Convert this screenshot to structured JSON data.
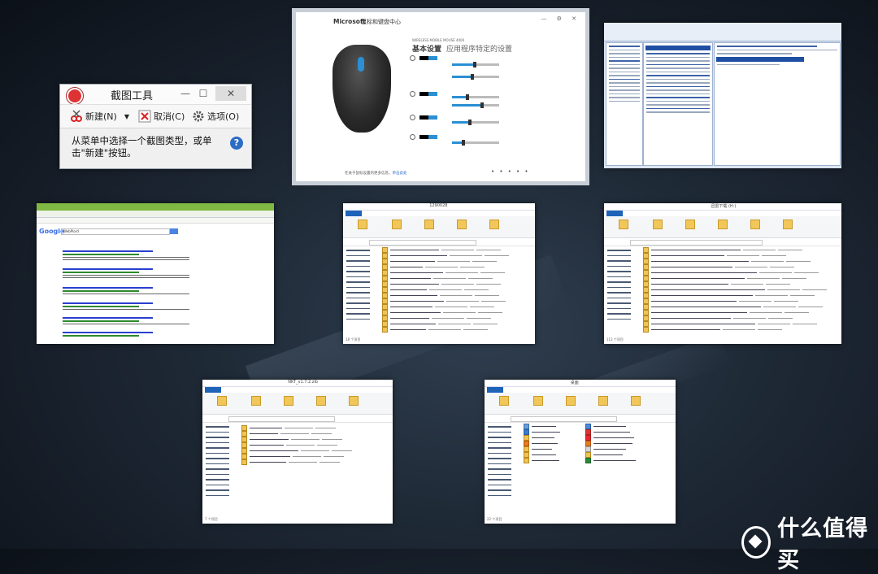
{
  "snipping_tool": {
    "title": "截图工具",
    "new_label": "新建(N)",
    "cancel_label": "取消(C)",
    "options_label": "选项(O)",
    "message": "从菜单中选择一个截图类型，或单击\"新建\"按钮。",
    "help_glyph": "?"
  },
  "mouse_center": {
    "brand": "Microsoft",
    "title": "鼠标和键盘中心",
    "model": "WIRELESS MOBILE MOUSE 4000",
    "heading": "基本设置",
    "heading_sub": "应用程序特定的设置",
    "window_controls": "— ⚙ ✕",
    "footer_text": "在关于鼠标设置的更多信息，",
    "footer_link": "单击此处",
    "page_dots": "• • • • •"
  },
  "browser": {
    "logo": "Google",
    "query": "WebPlord"
  },
  "explorer1": {
    "title": "1290028",
    "status": "18 个项目"
  },
  "explorer2": {
    "title": "迅雷下载 (H:)",
    "status": "112 个项目"
  },
  "explorer3": {
    "title": "NKT_v1.7.2.zib",
    "status": "7 个项目"
  },
  "explorer4": {
    "title": "桌面",
    "status": "22 个项目"
  },
  "watermark": {
    "text": "什么值得买"
  }
}
